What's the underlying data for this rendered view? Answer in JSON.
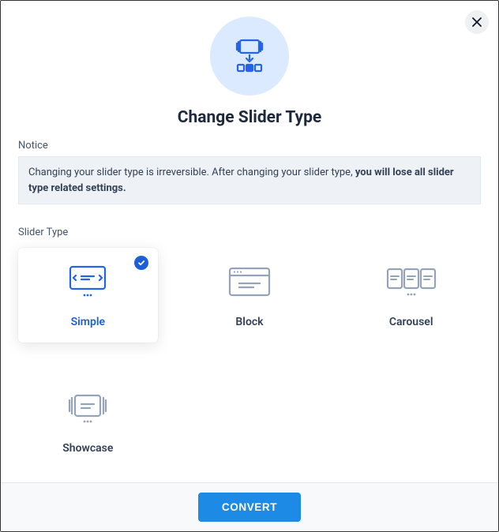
{
  "title": "Change Slider Type",
  "notice": {
    "label": "Notice",
    "text_normal": "Changing your slider type is irreversible. After changing your slider type, ",
    "text_bold": "you will lose all slider type related settings."
  },
  "slider_type": {
    "label": "Slider Type",
    "options": [
      {
        "id": "simple",
        "label": "Simple",
        "selected": true
      },
      {
        "id": "block",
        "label": "Block",
        "selected": false
      },
      {
        "id": "carousel",
        "label": "Carousel",
        "selected": false
      },
      {
        "id": "showcase",
        "label": "Showcase",
        "selected": false
      }
    ]
  },
  "actions": {
    "convert": "CONVERT"
  },
  "colors": {
    "primary": "#1d8ae6",
    "accent": "#1d5fd6",
    "hero_bg": "#dbeafe",
    "notice_bg": "#eef2f6"
  }
}
